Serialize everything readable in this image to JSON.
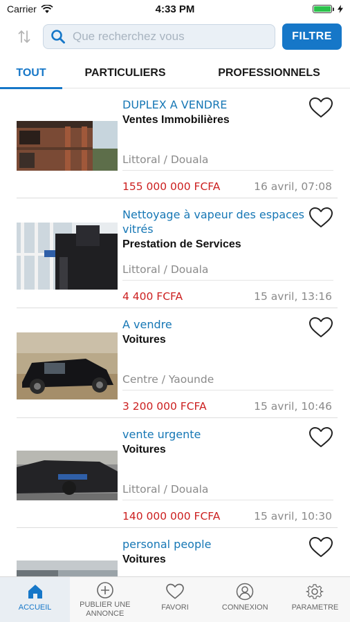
{
  "status": {
    "carrier": "Carrier",
    "time": "4:33 PM"
  },
  "search": {
    "placeholder": "Que recherchez vous",
    "filter_label": "FILTRE"
  },
  "tabs": [
    {
      "label": "TOUT",
      "active": true
    },
    {
      "label": "PARTICULIERS",
      "active": false
    },
    {
      "label": "PROFESSIONNELS",
      "active": false
    }
  ],
  "listings": [
    {
      "title": "DUPLEX A VENDRE",
      "category": "Ventes Immobilières",
      "location": "Littoral / Douala",
      "price": "155 000 000 FCFA",
      "date": "16 avril, 07:08"
    },
    {
      "title": "Nettoyage à vapeur des espaces vitrés",
      "category": "Prestation de Services",
      "location": "Littoral / Douala",
      "price": "4 400 FCFA",
      "date": "15 avril, 13:16"
    },
    {
      "title": "A vendre",
      "category": "Voitures",
      "location": "Centre / Yaounde",
      "price": "3 200 000 FCFA",
      "date": "15 avril, 10:46"
    },
    {
      "title": "vente urgente",
      "category": "Voitures",
      "location": "Littoral / Douala",
      "price": "140 000 000 FCFA",
      "date": "15 avril, 10:30"
    },
    {
      "title": "personal people",
      "category": "Voitures",
      "location": "",
      "price": "",
      "date": ""
    }
  ],
  "nav": [
    {
      "label": "ACCUEIL",
      "icon": "home-icon",
      "active": true
    },
    {
      "label": "PUBLIER UNE ANNONCE",
      "icon": "plus-circle-icon",
      "active": false
    },
    {
      "label": "FAVORI",
      "icon": "heart-icon",
      "active": false
    },
    {
      "label": "CONNEXION",
      "icon": "user-icon",
      "active": false
    },
    {
      "label": "PARAMETRE",
      "icon": "gear-icon",
      "active": false
    }
  ],
  "colors": {
    "accent": "#1677c8",
    "price": "#cc2020",
    "title": "#1677b5"
  }
}
